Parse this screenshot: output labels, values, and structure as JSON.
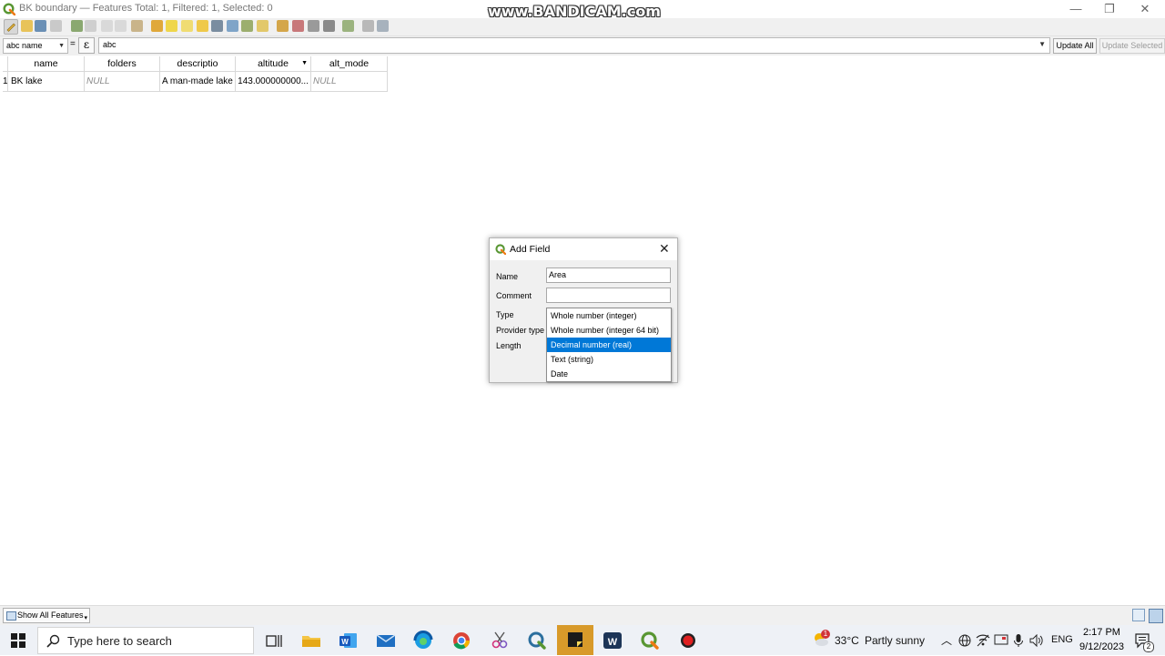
{
  "window": {
    "title": "BK boundary — Features Total: 1, Filtered: 1, Selected: 0",
    "watermark": "www.BANDICAM.com",
    "minimize": "—",
    "restore": "❐",
    "close": "✕"
  },
  "filter": {
    "field": "name",
    "field_type_tag": "abc",
    "equals": "=",
    "expression_button": "ε",
    "expression_value": "abc",
    "update_all": "Update All",
    "update_selected": "Update Selected"
  },
  "table": {
    "columns": [
      "name",
      "folders",
      "descriptio",
      "altitude",
      "alt_mode"
    ],
    "sort_indicator": "▼",
    "rows": [
      {
        "index": "1",
        "cells": [
          "BK lake",
          "NULL",
          "A man-made lake",
          "143.000000000...",
          "NULL"
        ]
      }
    ]
  },
  "dialog": {
    "title": "Add Field",
    "close": "✕",
    "labels": {
      "name": "Name",
      "comment": "Comment",
      "type": "Type",
      "provider_type": "Provider type",
      "length": "Length"
    },
    "name_value": "Area",
    "comment_value": "",
    "type_options": [
      "Whole number (integer)",
      "Whole number (integer 64 bit)",
      "Decimal number (real)",
      "Text (string)",
      "Date"
    ],
    "selected_type": "Decimal number (real)"
  },
  "bottom": {
    "show_all": "Show All Features"
  },
  "taskbar": {
    "search_placeholder": "Type here to search",
    "weather_temp": "33°C",
    "weather_desc": "Partly sunny",
    "language": "ENG",
    "time": "2:17 PM",
    "date": "9/12/2023",
    "notification_count": "2",
    "weather_badge": "1"
  },
  "colors": {
    "selection": "#0078d7",
    "qgis_green": "#589632"
  }
}
